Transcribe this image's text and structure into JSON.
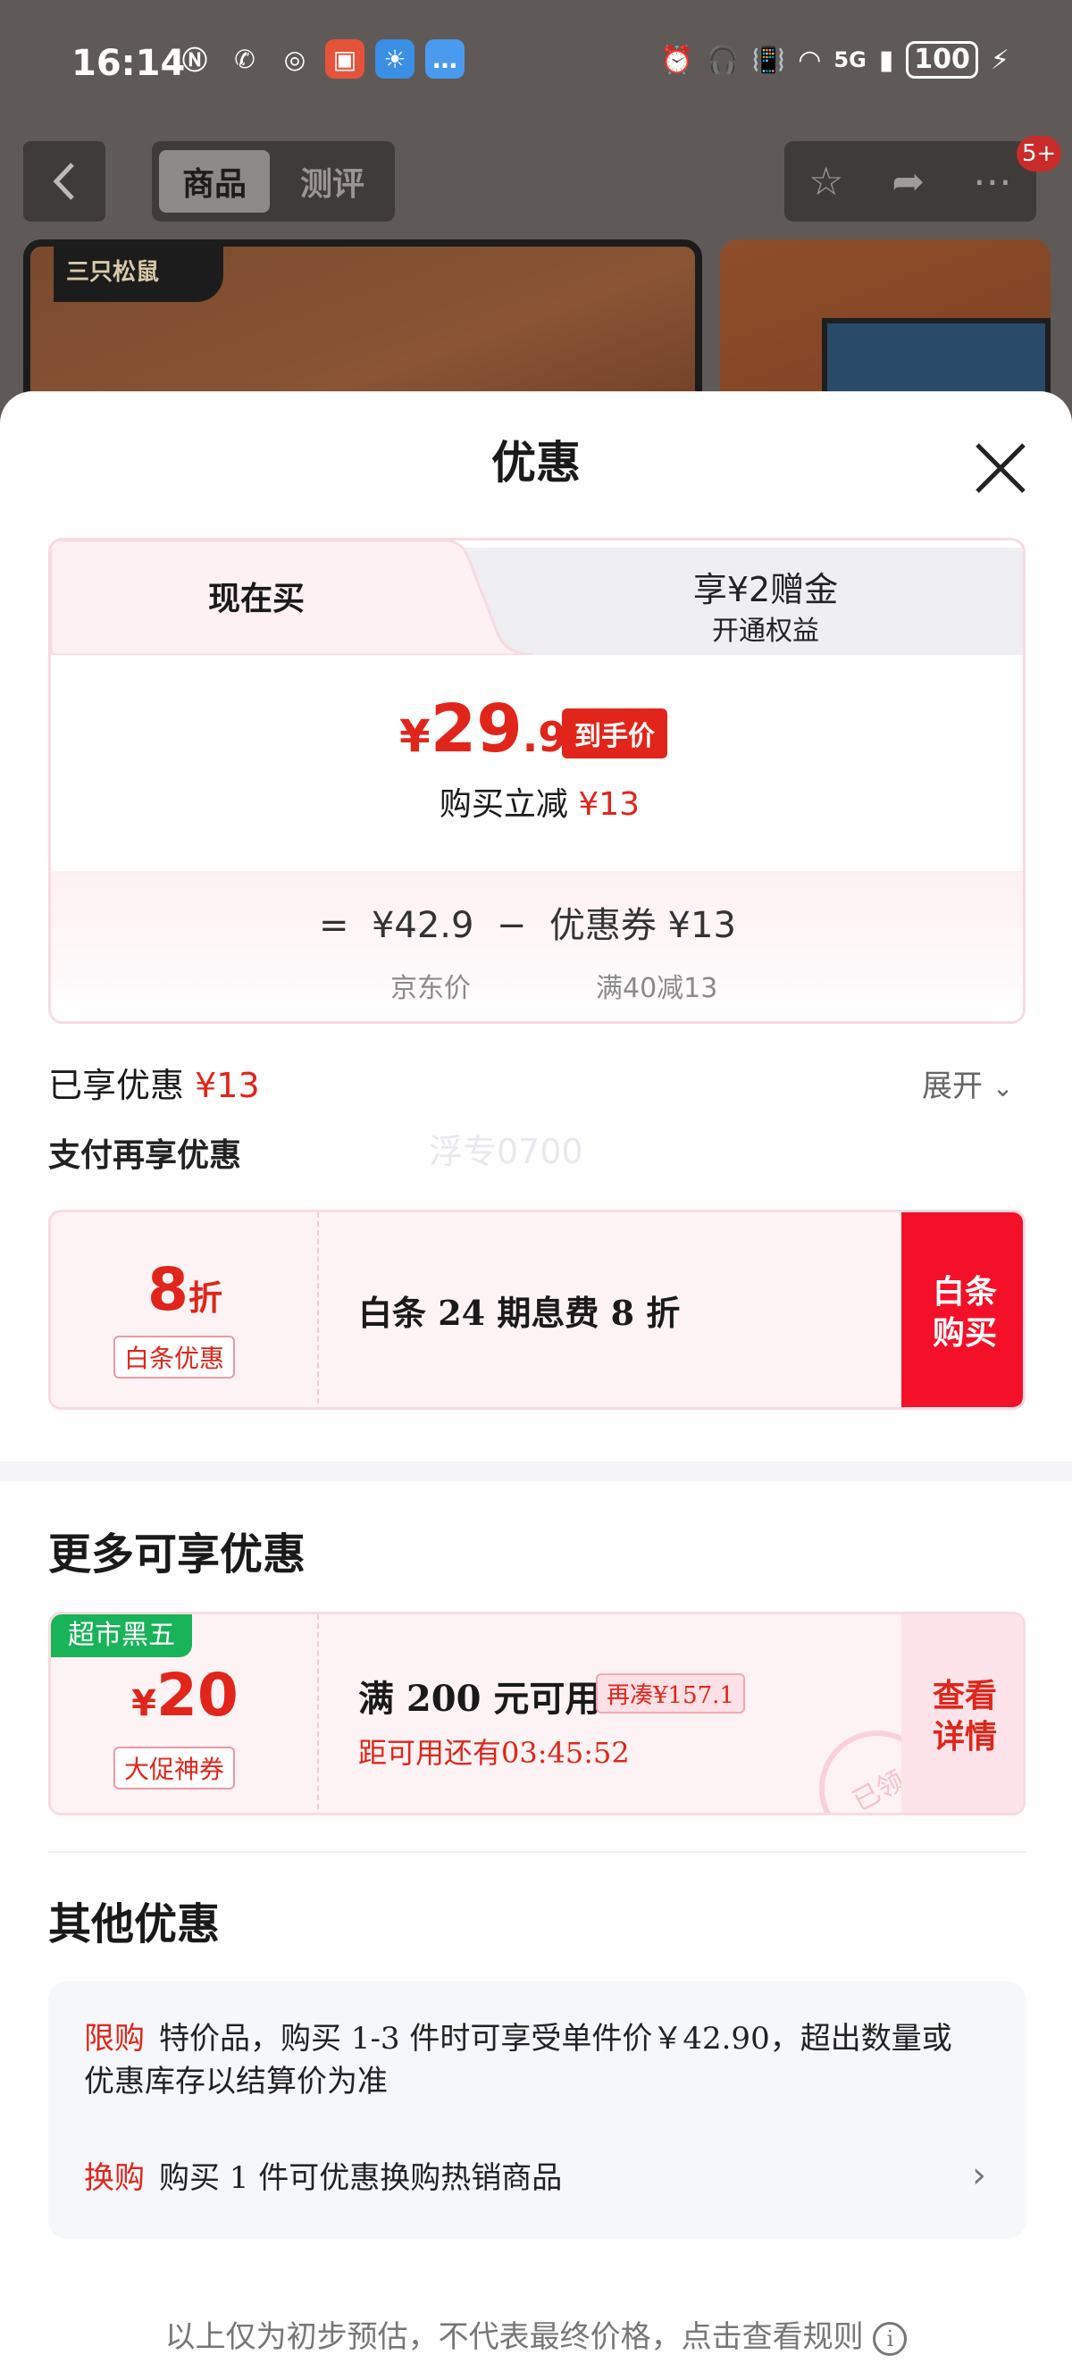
{
  "status_bar": {
    "time": "16:14",
    "signal": "5G",
    "battery": "100"
  },
  "nav": {
    "tab_active": "商品",
    "tab_inactive": "测评",
    "badge": "5+"
  },
  "backdrop": {
    "brand_logo": "三只松鼠"
  },
  "sheet": {
    "title": "优惠"
  },
  "price_card": {
    "tab_now": "现在买",
    "tab_other_line1": "享¥2赠金",
    "tab_other_line2": "开通权益",
    "price_currency": "¥",
    "price_integer": "29",
    "price_decimal": ".9",
    "price_tag": "到手价",
    "subtitle_prefix": "购买立减",
    "subtitle_value": "¥13",
    "calc_line": "=  ¥42.9  −  优惠券 ¥13",
    "calc_jd_label": "京东价",
    "calc_coupon_label": "满40减13"
  },
  "enjoyed": {
    "label": "已享优惠",
    "value": "¥13",
    "expand": "展开"
  },
  "payment": {
    "title": "支付再享优惠",
    "watermark": "浮专0700",
    "discount_num": "8",
    "discount_unit": "折",
    "label": "白条优惠",
    "text": "白条 24 期息费 8 折",
    "button": "白条购买"
  },
  "more": {
    "title": "更多可享优惠",
    "ribbon": "超市黑五",
    "currency": "¥",
    "amount": "20",
    "label": "大促神券",
    "condition": "满 200 元可用",
    "chip": "再凑¥157.1",
    "countdown": "距可用还有03:45:52",
    "button": "查看详情",
    "stamp": "已领"
  },
  "other": {
    "title": "其他优惠",
    "item1_tag": "限购",
    "item1_text": "特价品，购买 1-3 件时可享受单件价￥42.90，超出数量或优惠库存以结算价为准",
    "item2_tag": "换购",
    "item2_text": "购买 1 件可优惠换购热销商品"
  },
  "footer": {
    "note": "以上仅为初步预估，不代表最终价格，点击查看规则"
  },
  "colors": {
    "accent_red": "#e1251b",
    "button_red": "#f5102a",
    "ribbon_green": "#19b35a"
  }
}
